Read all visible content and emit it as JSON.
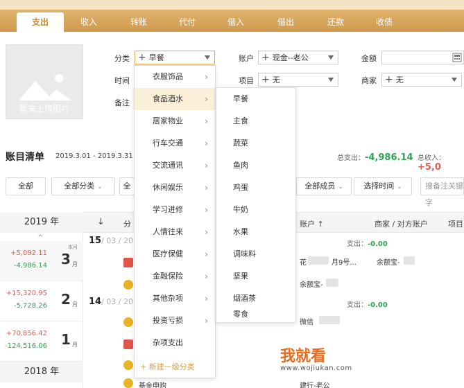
{
  "tabs": [
    "支出",
    "收入",
    "转账",
    "代付",
    "借入",
    "借出",
    "还款",
    "收债"
  ],
  "photo": {
    "label": "暂未上传图片"
  },
  "form": {
    "category_label": "分类",
    "category_value": "早餐",
    "account_label": "账户",
    "account_value": "现金--老公",
    "amount_label": "金额",
    "time_label": "时间",
    "project_label": "项目",
    "project_value": "无",
    "merchant_label": "商家",
    "merchant_value": "无",
    "note_label": "备注"
  },
  "ledger": {
    "title": "账目清单",
    "range": "2019.3.01 - 2019.3.31",
    "total_expense_label": "总支出：",
    "total_expense": "-4,986.14",
    "total_income_label": "总收入：",
    "total_income": "+5,0"
  },
  "filters": {
    "all": "全部",
    "all_categories": "全部分类",
    "all_prefix": "全",
    "all_members": "全部成员",
    "select_time": "选择时间",
    "search_placeholder": "搜备注关键字"
  },
  "list_header": {
    "year": "2019 年",
    "sort": "↓",
    "category_prefix": "分",
    "account": "账户 ↑",
    "merchant": "商家 / 对方账户",
    "project": "项目"
  },
  "months": [
    {
      "income": "+5,092.11",
      "expense": "-4,986.14",
      "month": "3",
      "unit": "月",
      "badge": "本月"
    },
    {
      "income": "+15,320.95",
      "expense": "-5,728.26",
      "month": "2",
      "unit": "月"
    },
    {
      "income": "+70,856.42",
      "expense": "-124,516.06",
      "month": "1",
      "unit": "月"
    }
  ],
  "year_2018": "2018 年",
  "days": [
    {
      "day": "15",
      "rest": "/ 03 / 2019",
      "summary_label": "支出：",
      "summary": "-0.00"
    },
    {
      "day": "14",
      "rest": "/ 03 / 2019",
      "summary_label": "支出：",
      "summary": "-0.00"
    }
  ],
  "rows": {
    "r1_account": "花",
    "r1_mid": "月9号...",
    "r1_merchant": "余额宝-",
    "r2_account": "余额宝-",
    "r3_account": "微信",
    "r4_cat": "基金申购",
    "r4_account": "建行-老公"
  },
  "categories_l1": [
    "衣服饰品",
    "食品酒水",
    "居家物业",
    "行车交通",
    "交流通讯",
    "休闲娱乐",
    "学习进修",
    "人情往来",
    "医疗保健",
    "金融保险",
    "其他杂项",
    "投资亏损",
    "杂项支出"
  ],
  "add_category": "新建一级分类",
  "categories_l2": [
    "早餐",
    "主食",
    "蔬菜",
    "鱼肉",
    "鸡蛋",
    "牛奶",
    "水果",
    "调味料",
    "坚果",
    "烟酒茶",
    "零食"
  ],
  "watermark": {
    "main": "我就看",
    "url": "www.wojiukan.com"
  },
  "colors": {
    "accent": "#cf9a4e",
    "income": "#e05a4a",
    "expense": "#2ea44f"
  }
}
